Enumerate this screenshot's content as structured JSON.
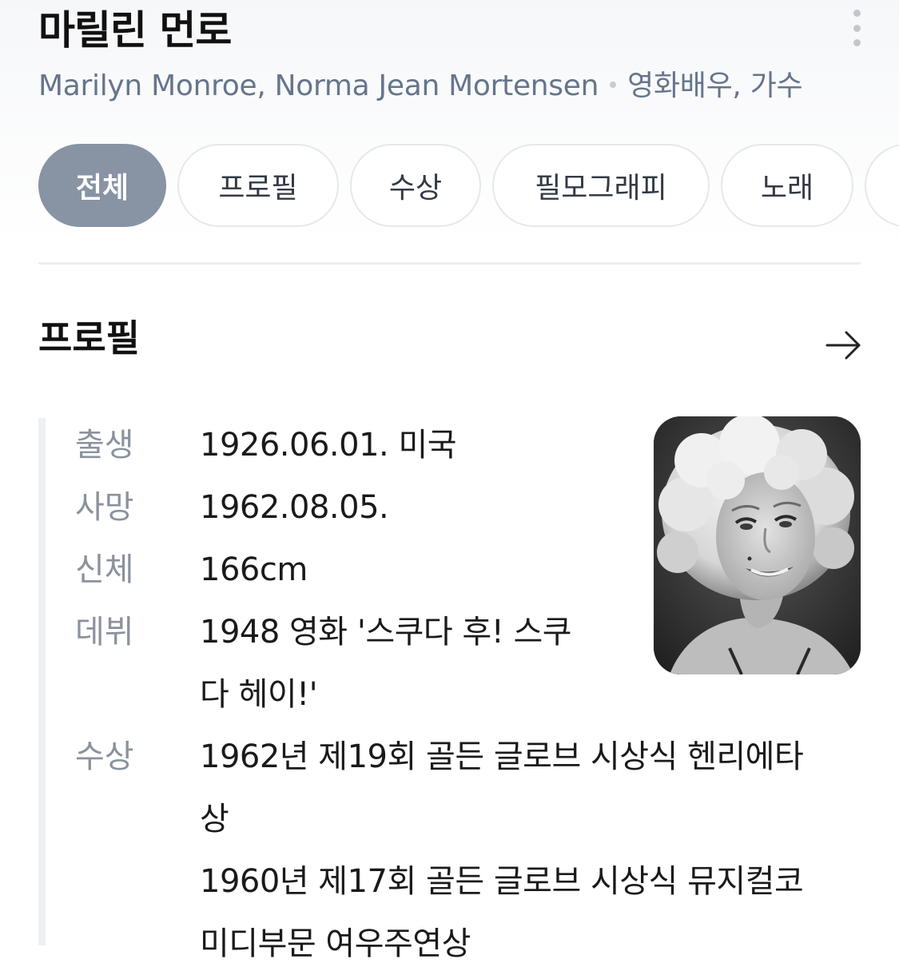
{
  "header": {
    "title": "마릴린 먼로",
    "subtitle_names": "Marilyn Monroe, Norma Jean Mortensen",
    "subtitle_roles": "영화배우, 가수",
    "more_icon": "more-vertical-icon"
  },
  "tabs": [
    {
      "label": "전체",
      "active": true
    },
    {
      "label": "프로필",
      "active": false
    },
    {
      "label": "수상",
      "active": false
    },
    {
      "label": "필모그래피",
      "active": false
    },
    {
      "label": "노래",
      "active": false
    },
    {
      "label": "",
      "active": false
    }
  ],
  "profile": {
    "section_title": "프로필",
    "arrow_icon": "arrow-right-icon",
    "photo_icon": "portrait-photo",
    "rows": [
      {
        "label": "출생",
        "values": [
          "1926.06.01. 미국"
        ]
      },
      {
        "label": "사망",
        "values": [
          "1962.08.05."
        ]
      },
      {
        "label": "신체",
        "values": [
          "166cm"
        ]
      },
      {
        "label": "데뷔",
        "values": [
          "1948 영화 '스쿠다 후! 스쿠다 헤이!'"
        ]
      },
      {
        "label": "수상",
        "values": [
          "1962년 제19회 골든 글로브 시상식 헨리에타상",
          "1960년 제17회 골든 글로브 시상식 뮤지컬코미디부문 여우주연상"
        ]
      }
    ]
  },
  "colors": {
    "active_tab_bg": "#8893a4",
    "subtitle_text": "#66758c",
    "label_text": "#8a929d"
  }
}
